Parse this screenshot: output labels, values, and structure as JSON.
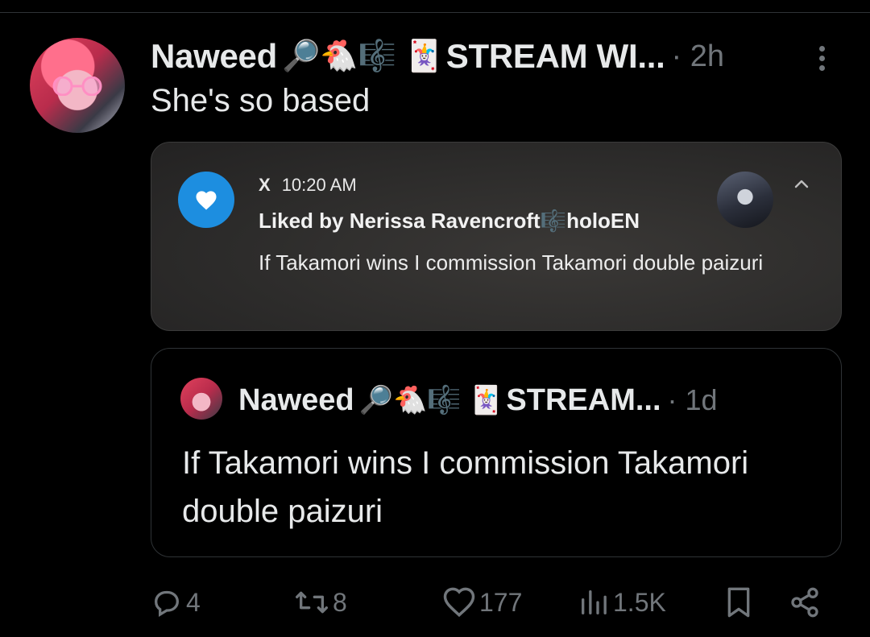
{
  "tweet": {
    "author_name": "Naweed",
    "author_emojis": "🔎🐔🎼 🃏",
    "author_suffix": "STREAM WI...",
    "time": "· 2h",
    "text": "She's so based"
  },
  "notification": {
    "app": "X",
    "time": "10:20 AM",
    "title": "Liked by Nerissa Ravencroft🎼holoEN",
    "body": "If Takamori wins I commission Takamori double paizuri",
    "icon_color": "#1d8ee0"
  },
  "quoted": {
    "author_name": "Naweed",
    "author_emojis": "🔎🐔🎼 🃏",
    "author_suffix": "STREAM...",
    "time": "· 1d",
    "text": "If Takamori wins I commission Takamori double paizuri"
  },
  "actions": {
    "replies": "4",
    "reposts": "8",
    "likes": "177",
    "views": "1.5K"
  },
  "icons": [
    "more-vertical-icon",
    "heart-icon",
    "chevron-up-icon",
    "reply-icon",
    "repost-icon",
    "like-icon",
    "views-icon",
    "bookmark-icon",
    "share-icon"
  ],
  "colors": {
    "background": "#000000",
    "text": "#e7e9ea",
    "muted": "#71767b",
    "accent": "#1d8ee0"
  }
}
